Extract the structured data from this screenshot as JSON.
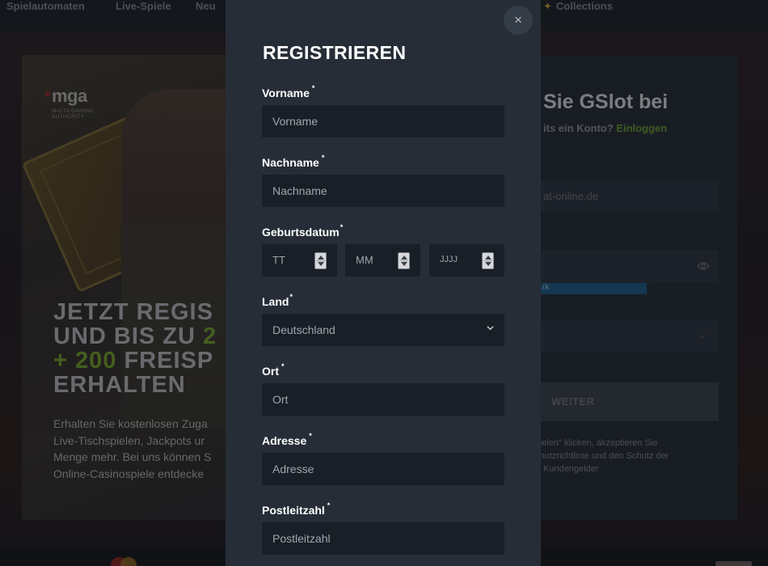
{
  "topnav": {
    "items": [
      "Spielautomaten",
      "Live-Spiele",
      "Neu",
      "Collections"
    ]
  },
  "promo": {
    "mga_brand": "mga",
    "mga_sub_line1": "MALTA GAMING",
    "mga_sub_line2": "AUTHORITY",
    "headline_line1": "JETZT REGIS",
    "headline_line2_prefix": "UND BIS ZU ",
    "headline_line2_num": "2",
    "headline_line3_green": "+ 200",
    "headline_line3_rest": " FREISP",
    "headline_line4": "ERHALTEN",
    "body_lines": [
      "Erhalten Sie kostenlosen Zuga",
      "Live-Tischspielen, Jackpots ur",
      "Menge mehr. Bei uns können S",
      "Online-Casinospiele entdecke"
    ]
  },
  "right_panel": {
    "title": "Sie GSlot bei",
    "subtitle_prefix": "its ein Konto? ",
    "login_link": "Einloggen",
    "email_partial": "at-online.de",
    "strength_text": "rk",
    "continue_button": "WEITER",
    "legal_lines": [
      "t spielen\" klicken, akzeptieren Sie",
      "chutzrichtlinie und den Schutz der",
      "Kundengelder"
    ]
  },
  "colors": {
    "modal_bg": "#262d37",
    "input_bg": "#191f27",
    "accent_green": "#74a22a"
  },
  "modal": {
    "title": "REGISTRIEREN",
    "close_label": "×",
    "fields": {
      "first_name": {
        "label": "Vorname",
        "placeholder": "Vorname",
        "required_mark": "*"
      },
      "last_name": {
        "label": "Nachname",
        "placeholder": "Nachname",
        "required_mark": "*"
      },
      "birthdate": {
        "label": "Geburtsdatum",
        "required_mark": "*",
        "day_placeholder": "TT",
        "month_placeholder": "MM",
        "year_placeholder": "JJJJ"
      },
      "country": {
        "label": "Land",
        "required_mark": "*",
        "selected": "Deutschland"
      },
      "city": {
        "label": "Ort",
        "placeholder": "Ort",
        "required_mark": "*"
      },
      "address": {
        "label": "Adresse",
        "placeholder": "Adresse",
        "required_mark": "*"
      },
      "postcode": {
        "label": "Postleitzahl",
        "placeholder": "Postleitzahl",
        "required_mark": "*"
      }
    }
  }
}
